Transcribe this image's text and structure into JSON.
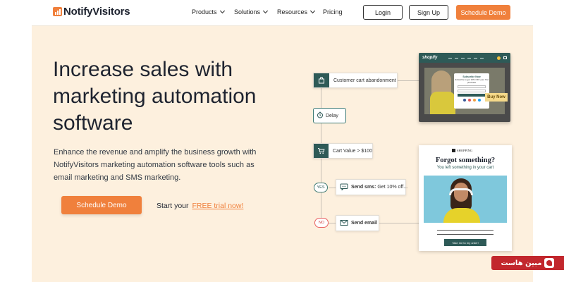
{
  "colors": {
    "accent": "#f0803c",
    "brand_dark": "#2e5a57",
    "page_bg": "#fdf0de",
    "watermark": "#c2272d"
  },
  "header": {
    "logo_text": "NotifyVisitors",
    "logo_icon": "bar-chart-icon",
    "nav": [
      {
        "label": "Products",
        "has_dropdown": true
      },
      {
        "label": "Solutions",
        "has_dropdown": true
      },
      {
        "label": "Resources",
        "has_dropdown": true
      },
      {
        "label": "Pricing",
        "has_dropdown": false
      }
    ],
    "login_label": "Login",
    "signup_label": "Sign Up",
    "demo_label": "Schedule Demo"
  },
  "hero": {
    "title_line1": "Increase sales with",
    "title_line2": "marketing automation",
    "title_line3": "software",
    "description": "Enhance the revenue and amplify the business growth with NotifyVisitors marketing automation software tools such as email marketing and SMS marketing.",
    "cta_label": "Schedule Demo",
    "trial_prefix": "Start your",
    "trial_link": "FREE trial now!"
  },
  "flow": {
    "step1": {
      "label": "Customer cart abandonment",
      "icon": "shopping-bag-icon"
    },
    "delay": {
      "label": "Delay",
      "icon": "clock-icon"
    },
    "condition": {
      "label": "Cart Value > $100",
      "icon": "cart-icon"
    },
    "yes": {
      "pill": "YES",
      "bold": "Send sms:",
      "text": "Get 10% off...",
      "icon": "message-icon"
    },
    "no": {
      "pill": "NO",
      "bold": "Send email",
      "icon": "envelope-icon"
    }
  },
  "shop_mock": {
    "brand": "shopify",
    "popup_title": "Subscribe Now",
    "popup_text": "Subscribe to get 10% OFF your first purchase",
    "popup_button": "SUBSCRIBE",
    "buy_label": "Buy Now"
  },
  "email_mock": {
    "brand": "SHOPPING",
    "title": "Forgot something?",
    "subtitle": "You left something in your cart",
    "button": "Take me to my order!"
  },
  "watermark": {
    "text": "مبین هاست"
  }
}
